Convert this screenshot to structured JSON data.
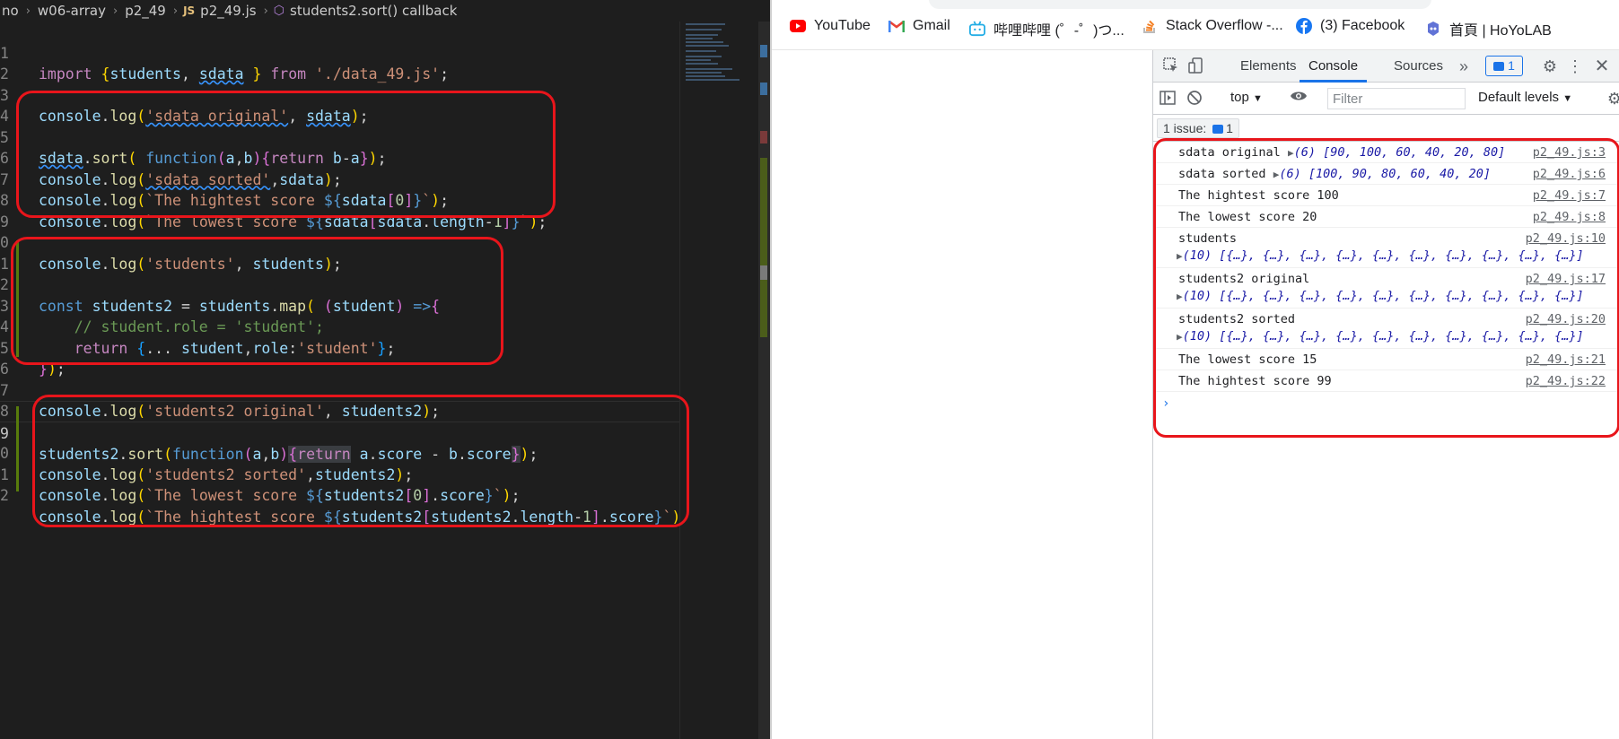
{
  "editor": {
    "breadcrumb": {
      "items": [
        "no",
        "w06-array",
        "p2_49",
        "p2_49.js",
        "students2.sort() callback"
      ],
      "file_badge": "JS"
    },
    "lines": [
      {
        "n": "1"
      },
      {
        "n": "2"
      },
      {
        "n": "3"
      },
      {
        "n": "4"
      },
      {
        "n": "5"
      },
      {
        "n": "6"
      },
      {
        "n": "7"
      },
      {
        "n": "8"
      },
      {
        "n": "9"
      },
      {
        "n": "0"
      },
      {
        "n": "1"
      },
      {
        "n": "2"
      },
      {
        "n": "3"
      },
      {
        "n": "4"
      },
      {
        "n": "5"
      },
      {
        "n": "6"
      },
      {
        "n": "7"
      },
      {
        "n": "8"
      },
      {
        "n": "9"
      },
      {
        "n": "0"
      },
      {
        "n": "1"
      },
      {
        "n": "2"
      }
    ],
    "code": {
      "l1": [
        "import",
        " {",
        "students",
        ", ",
        "sdata",
        " }",
        " from",
        " './data_49.js'",
        ";"
      ],
      "l3": [
        "console",
        ".",
        "log",
        "(",
        "'sdata original'",
        ", ",
        "sdata",
        ")",
        ";"
      ],
      "l5": [
        "sdata",
        ".",
        "sort",
        "(",
        " function",
        "(",
        "a",
        ",",
        "b",
        ")",
        "{",
        "return",
        " b",
        "-",
        "a",
        "}",
        ")",
        ";"
      ],
      "l6": [
        "console",
        ".",
        "log",
        "(",
        "'sdata sorted'",
        ",",
        "sdata",
        ")",
        ";"
      ],
      "l7": [
        "console",
        ".",
        "log",
        "(",
        "`The hightest score ",
        "${",
        "sdata",
        "[",
        "0",
        "]",
        "}",
        "`",
        ")",
        ";"
      ],
      "l8": [
        "console",
        ".",
        "log",
        "(",
        "`The lowest score ",
        "${",
        "sdata",
        "[",
        "sdata",
        ".",
        "length",
        "-",
        "1",
        "]",
        "}",
        "`",
        ")",
        ";"
      ],
      "l10": [
        "console",
        ".",
        "log",
        "(",
        "'students'",
        ", ",
        "students",
        ")",
        ";"
      ],
      "l12": [
        "const",
        " students2",
        " =",
        " students",
        ".",
        "map",
        "(",
        " (",
        "student",
        ")",
        " =>",
        "{"
      ],
      "l13": [
        "    // student.role = 'student';"
      ],
      "l14": [
        "    return",
        " {",
        "...",
        " student",
        ",",
        "role",
        ":",
        "'student'",
        "}",
        ";"
      ],
      "l15": [
        "}",
        ")",
        ";"
      ],
      "l17": [
        "console",
        ".",
        "log",
        "(",
        "'students2 original'",
        ", ",
        "students2",
        ")",
        ";"
      ],
      "l19": [
        "students2",
        ".",
        "sort",
        "(",
        "function",
        "(",
        "a",
        ",",
        "b",
        ")",
        "{",
        "return",
        " a",
        ".",
        "score",
        " -",
        " b",
        ".",
        "score",
        "}",
        ")",
        ";"
      ],
      "l20": [
        "console",
        ".",
        "log",
        "(",
        "'students2 sorted'",
        ",",
        "students2",
        ")",
        ";"
      ],
      "l21": [
        "console",
        ".",
        "log",
        "(",
        "`The lowest score ",
        "${",
        "students2",
        "[",
        "0",
        "]",
        ".",
        "score",
        "}",
        "`",
        ")",
        ";"
      ],
      "l22": [
        "console",
        ".",
        "log",
        "(",
        "`The hightest score ",
        "${",
        "students2",
        "[",
        "students2",
        ".",
        "length",
        "-",
        "1",
        "]",
        ".",
        "score",
        "}",
        "`",
        ")",
        ";"
      ]
    }
  },
  "browser": {
    "bookmarks": [
      {
        "label": "YouTube",
        "icon": "youtube-icon"
      },
      {
        "label": "Gmail",
        "icon": "gmail-icon"
      },
      {
        "label": "哔哩哔哩 (゜-゜)つ...",
        "icon": "bilibili-icon"
      },
      {
        "label": "Stack Overflow -...",
        "icon": "stackoverflow-icon"
      },
      {
        "label": "(3) Facebook",
        "icon": "facebook-icon"
      },
      {
        "label": "首頁 | HoYoLAB",
        "icon": "hoyolab-icon"
      }
    ],
    "devtools": {
      "tabs": [
        "Elements",
        "Console",
        "Sources"
      ],
      "active_tab": "Console",
      "issues_count": "1",
      "context": "top",
      "filter_placeholder": "Filter",
      "levels": "Default levels",
      "issue_bar": "1 issue:",
      "issue_bar_count": "1",
      "messages": [
        {
          "text": "sdata original",
          "obj_prefix": "(6) ",
          "obj": "[90, 100, 60, 40, 20, 80]",
          "source": "p2_49.js:3",
          "two_line": false
        },
        {
          "text": "sdata sorted",
          "obj_prefix": "(6) ",
          "obj": "[100, 90, 80, 60, 40, 20]",
          "source": "p2_49.js:6",
          "two_line": false
        },
        {
          "text": "The hightest score 100",
          "source": "p2_49.js:7",
          "two_line": false
        },
        {
          "text": "The lowest score 20",
          "source": "p2_49.js:8",
          "two_line": false
        },
        {
          "text": "students",
          "obj_prefix": "(10) ",
          "obj": "[{…}, {…}, {…}, {…}, {…}, {…}, {…}, {…}, {…}, {…}]",
          "source": "p2_49.js:10",
          "two_line": true
        },
        {
          "text": "students2 original",
          "obj_prefix": "(10) ",
          "obj": "[{…}, {…}, {…}, {…}, {…}, {…}, {…}, {…}, {…}, {…}]",
          "source": "p2_49.js:17",
          "two_line": true
        },
        {
          "text": "students2 sorted",
          "obj_prefix": "(10) ",
          "obj": "[{…}, {…}, {…}, {…}, {…}, {…}, {…}, {…}, {…}, {…}]",
          "source": "p2_49.js:20",
          "two_line": true
        },
        {
          "text": "The lowest score 15",
          "source": "p2_49.js:21",
          "two_line": false
        },
        {
          "text": "The hightest score 99",
          "source": "p2_49.js:22",
          "two_line": false
        }
      ],
      "prompt": "›"
    }
  },
  "colors": {
    "annotation": "#e8151b",
    "accent": "#1a73e8"
  }
}
